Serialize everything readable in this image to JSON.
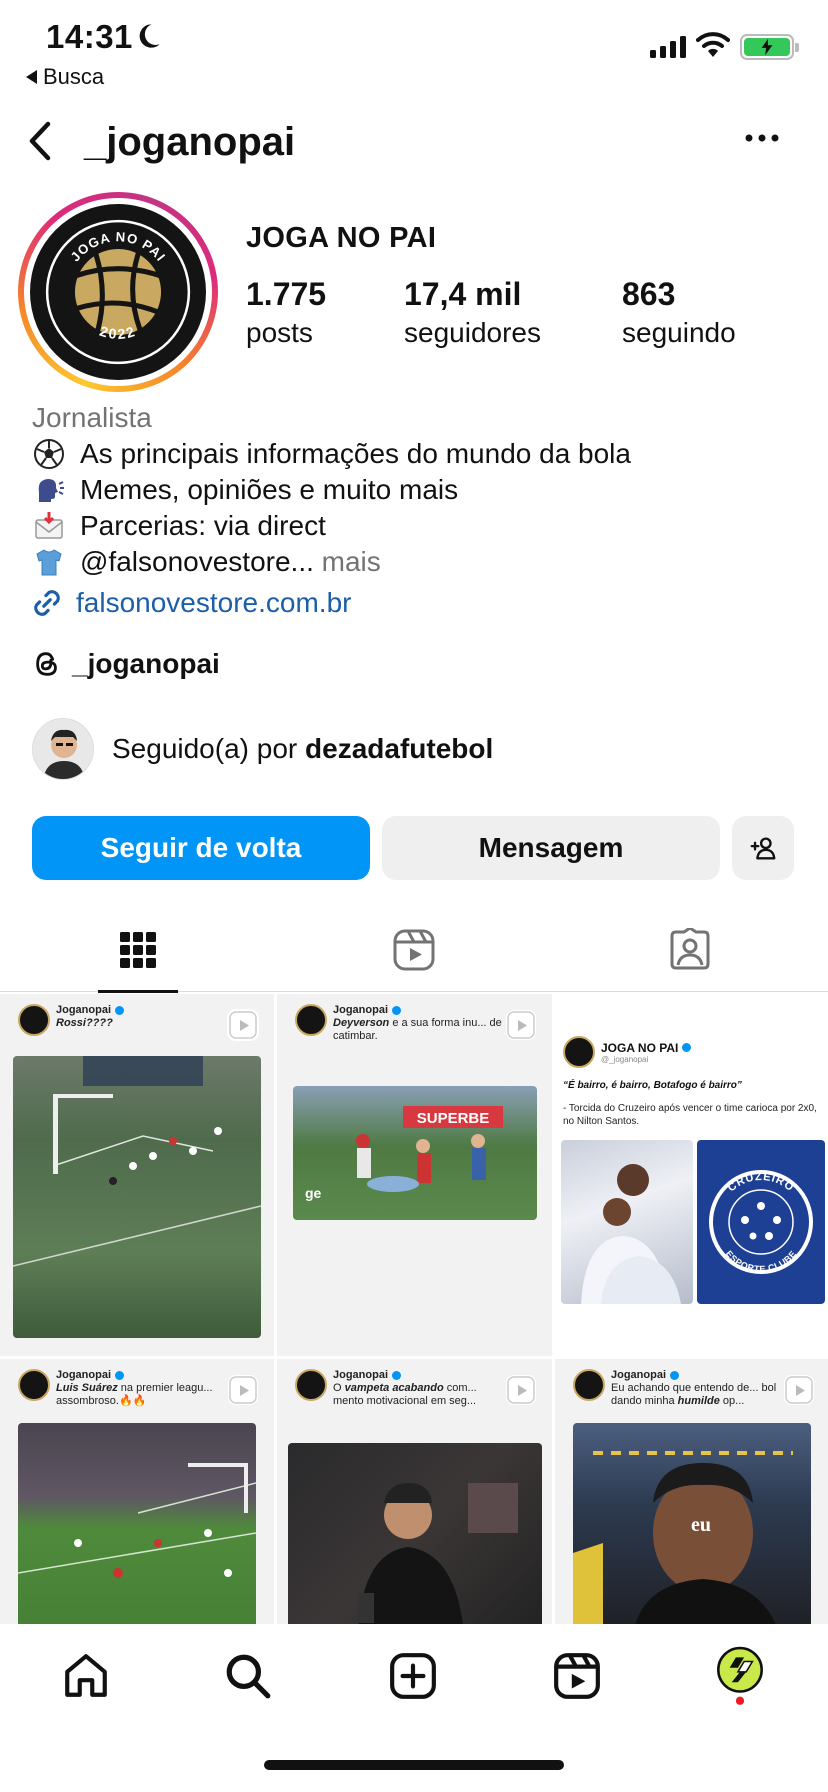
{
  "status_bar": {
    "time": "14:31",
    "back_app": "Busca",
    "battery_color": "#34c759"
  },
  "header": {
    "username": "_joganopai",
    "back_icon": "chevron-left-icon",
    "more_icon": "more-horizontal-icon"
  },
  "profile": {
    "avatar_text_top": "JOGA NO PAI",
    "avatar_text_bottom": "2022",
    "display_name": "JOGA NO PAI",
    "stats": [
      {
        "value": "1.775",
        "label": "posts"
      },
      {
        "value": "17,4 mil",
        "label": "seguidores"
      },
      {
        "value": "863",
        "label": "seguindo"
      }
    ],
    "category": "Jornalista",
    "bio_lines": [
      {
        "icon": "soccer-ball-icon",
        "text": "As principais informações do mundo da bola"
      },
      {
        "icon": "speaking-head-icon",
        "text": "Memes, opiniões e muito mais"
      },
      {
        "icon": "envelope-icon",
        "text": "Parcerias: via direct"
      },
      {
        "icon": "shirt-icon",
        "text": "@falsonovestore..."
      }
    ],
    "bio_more": "mais",
    "link": "falsonovestore.com.br",
    "threads_handle": "_joganopai",
    "followed_by_prefix": "Seguido(a) por",
    "followed_by_user": "dezadafutebol"
  },
  "actions": {
    "follow_back": "Seguir de volta",
    "message": "Mensagem"
  },
  "tabs": [
    {
      "icon": "grid-icon",
      "active": true
    },
    {
      "icon": "reels-icon",
      "active": false
    },
    {
      "icon": "tagged-icon",
      "active": false
    }
  ],
  "posts": [
    {
      "account": "Joganopai",
      "caption": "Rossi????",
      "type": "reel"
    },
    {
      "account": "Joganopai",
      "caption": "Deyverson e a sua forma inu... de catimbar.",
      "caption_bold": "Deyverson",
      "caption_rest": " e a sua forma inu... de catimbar.",
      "type": "reel",
      "watermark": "ge",
      "banner": "SUPERBE"
    },
    {
      "account": "JOGA NO PAI",
      "handle": "@_joganopai",
      "quote": "“É bairro, é bairro, Botafogo é bairro”",
      "caption": "- Torcida do Cruzeiro após vencer o time carioca por 2x0, no Nilton Santos.",
      "badge_text_top": "CRUZEIRO",
      "badge_text_bottom": "ESPORTE CLUBE",
      "type": "image"
    },
    {
      "account": "Joganopai",
      "caption_bold": "Luis Suárez",
      "caption_rest": " na premier leagu... assombroso.🔥🔥",
      "type": "reel"
    },
    {
      "account": "Joganopai",
      "caption_pre": "O ",
      "caption_bold": "vampeta acabando",
      "caption_rest": " com... mento motivacional em seg...",
      "type": "reel"
    },
    {
      "account": "Joganopai",
      "caption_pre": "Eu achando que entendo de... bol dando minha ",
      "caption_bold": "humilde",
      "caption_rest": " op...",
      "overlay": "eu",
      "type": "reel"
    }
  ],
  "bottom_nav": [
    {
      "icon": "home-icon"
    },
    {
      "icon": "search-icon"
    },
    {
      "icon": "create-post-icon"
    },
    {
      "icon": "reels-icon"
    },
    {
      "icon": "profile-avatar-icon"
    }
  ],
  "colors": {
    "accent": "#0095f6",
    "link": "#1c5fa8",
    "muted": "#737373",
    "logo_gold": "#c9a861",
    "cruzeiro_blue": "#1d3f94"
  }
}
